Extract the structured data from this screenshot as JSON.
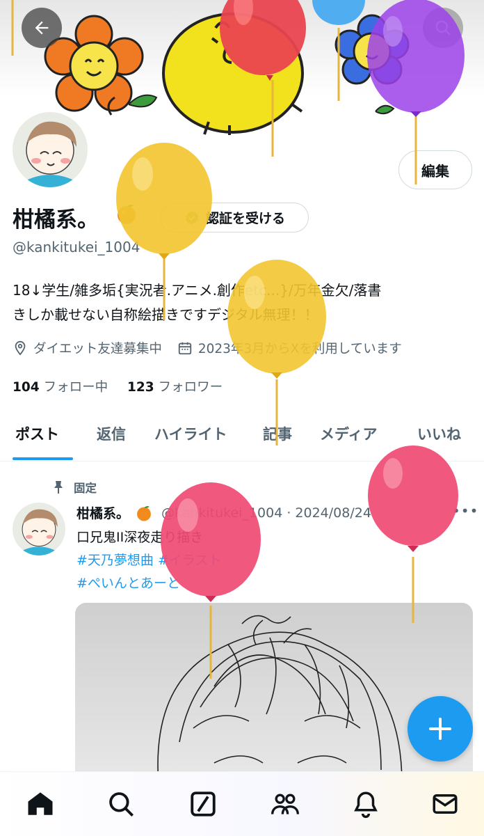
{
  "profile": {
    "name": "柑橘系。",
    "handle": "@kankitukei_1004",
    "bio_line1": "18↓学生/雑多垢{実況者.アニメ.創作etc...}/万年金欠/落書",
    "bio_line2": "きしか載せない自称絵描きですデジタル無理！！",
    "location": "ダイエット友達募集中",
    "joined": "2023年3月からXを利用しています",
    "following_count": "104",
    "following_label": "フォロー中",
    "followers_count": "123",
    "followers_label": "フォロワー",
    "edit_label": "編集",
    "verify_label": "認証を受ける"
  },
  "tabs": [
    {
      "label": "ポスト"
    },
    {
      "label": "返信"
    },
    {
      "label": "ハイライト"
    },
    {
      "label": "記事"
    },
    {
      "label": "メディア"
    },
    {
      "label": "いいね"
    }
  ],
  "post": {
    "pinned_label": "固定",
    "author": "柑橘系。",
    "handle_date": "@kankitukei_1004 · 2024/08/24",
    "text": "口兄鬼II深夜走り描き",
    "tag_line1": "#天乃夢想曲 #イラスト",
    "tag_line2": "#ぺいんとあーと"
  },
  "colors": {
    "accent": "#1d9bf0",
    "balloon_yellow": "#f2c531",
    "balloon_pink": "#ef4a73",
    "balloon_red": "#e9454f",
    "balloon_purple": "#9b42e8",
    "balloon_blue": "#3fa6ef"
  },
  "icons": {
    "back": "arrow-left-icon",
    "search": "search-icon",
    "location": "location-pin-icon",
    "calendar": "calendar-icon",
    "verified": "verified-badge-icon",
    "pin": "pin-icon",
    "more": "more-horizontal-icon",
    "compose": "plus-icon",
    "nav": [
      "home-icon",
      "search-icon",
      "grok-icon",
      "communities-icon",
      "bell-icon",
      "mail-icon"
    ]
  }
}
